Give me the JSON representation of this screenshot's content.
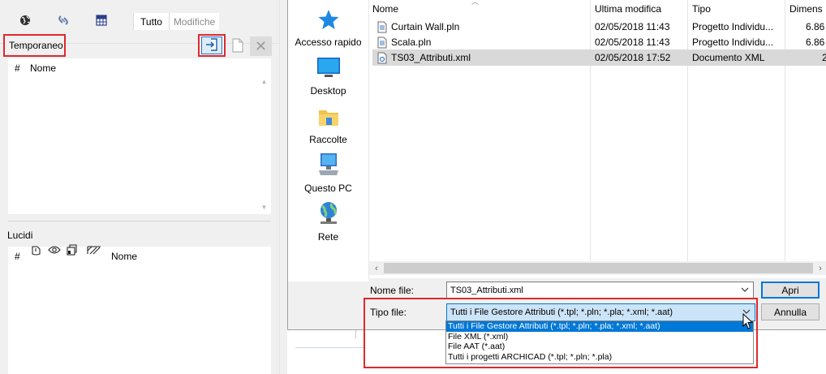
{
  "left_panel": {
    "tabs": [
      {
        "icon": "globe-icon"
      },
      {
        "icon": "link-icon"
      },
      {
        "icon": "grid-icon"
      },
      {
        "label": "Tutto"
      },
      {
        "label": "Modifiche"
      }
    ],
    "temp_section": {
      "title": "Temporaneo",
      "columns": [
        "#",
        "Nome"
      ]
    },
    "lucidi_section": {
      "title": "Lucidi",
      "columns": [
        "#",
        "Nome"
      ]
    },
    "highlight_color": "#e0282e"
  },
  "dialog": {
    "nav": [
      {
        "label": "Accesso rapido",
        "icon": "star-icon"
      },
      {
        "label": "Desktop",
        "icon": "desktop-icon"
      },
      {
        "label": "Raccolte",
        "icon": "library-icon"
      },
      {
        "label": "Questo PC",
        "icon": "computer-icon"
      },
      {
        "label": "Rete",
        "icon": "network-icon"
      }
    ],
    "columns": {
      "name": "Nome",
      "modified": "Ultima modifica",
      "type": "Tipo",
      "size": "Dimens"
    },
    "files": [
      {
        "name": "Curtain Wall.pln",
        "modified": "02/05/2018 11:43",
        "type": "Progetto Individu...",
        "size": "6.86",
        "icon": "pln-file-icon",
        "selected": false
      },
      {
        "name": "Scala.pln",
        "modified": "02/05/2018 11:43",
        "type": "Progetto Individu...",
        "size": "6.86",
        "icon": "pln-file-icon",
        "selected": false
      },
      {
        "name": "TS03_Attributi.xml",
        "modified": "02/05/2018 17:52",
        "type": "Documento XML",
        "size": "2",
        "icon": "xml-file-icon",
        "selected": true
      }
    ],
    "filename_label": "Nome file:",
    "filename_value": "TS03_Attributi.xml",
    "filetype_label": "Tipo file:",
    "filetype_value": "Tutti i File Gestore Attributi (*.tpl; *.pln; *.pla; *.xml; *.aat)",
    "filetype_options": [
      "Tutti i File Gestore Attributi (*.tpl; *.pln; *.pla; *.xml; *.aat)",
      "File XML (*.xml)",
      "File AAT (*.aat)",
      "Tutti i progetti ARCHICAD (*.tpl; *.pln; *.pla)"
    ],
    "selected_option_index": 0,
    "open_button": "Apri",
    "cancel_button": "Annulla",
    "accent_color": "#0078d7"
  }
}
